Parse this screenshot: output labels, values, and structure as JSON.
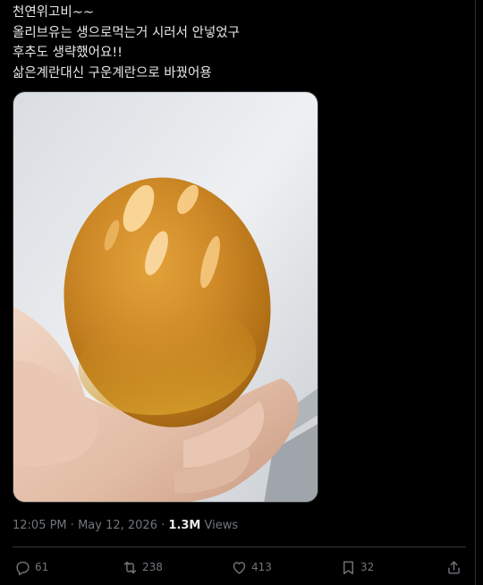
{
  "tweet": {
    "lines": [
      "천연위고비~~",
      "올리브유는 생으로먹는거 시러서 안넣었구",
      "후추도 생략했어요!!",
      "삶은계란대신 구운계란으로 바꿨어용"
    ]
  },
  "meta": {
    "time": "12:05 PM",
    "separator": "·",
    "date": "May 12, 2026",
    "views_count": "1.3M",
    "views_label": "Views"
  },
  "actions": {
    "reply_count": "61",
    "retweet_count": "238",
    "like_count": "413",
    "bookmark_count": "32"
  },
  "icons": {
    "reply": "reply-icon",
    "retweet": "retweet-icon",
    "like": "heart-icon",
    "bookmark": "bookmark-icon",
    "share": "share-icon"
  },
  "colors": {
    "background": "#000000",
    "text": "#e7e9ea",
    "muted": "#71767b",
    "border": "#2f3336"
  }
}
